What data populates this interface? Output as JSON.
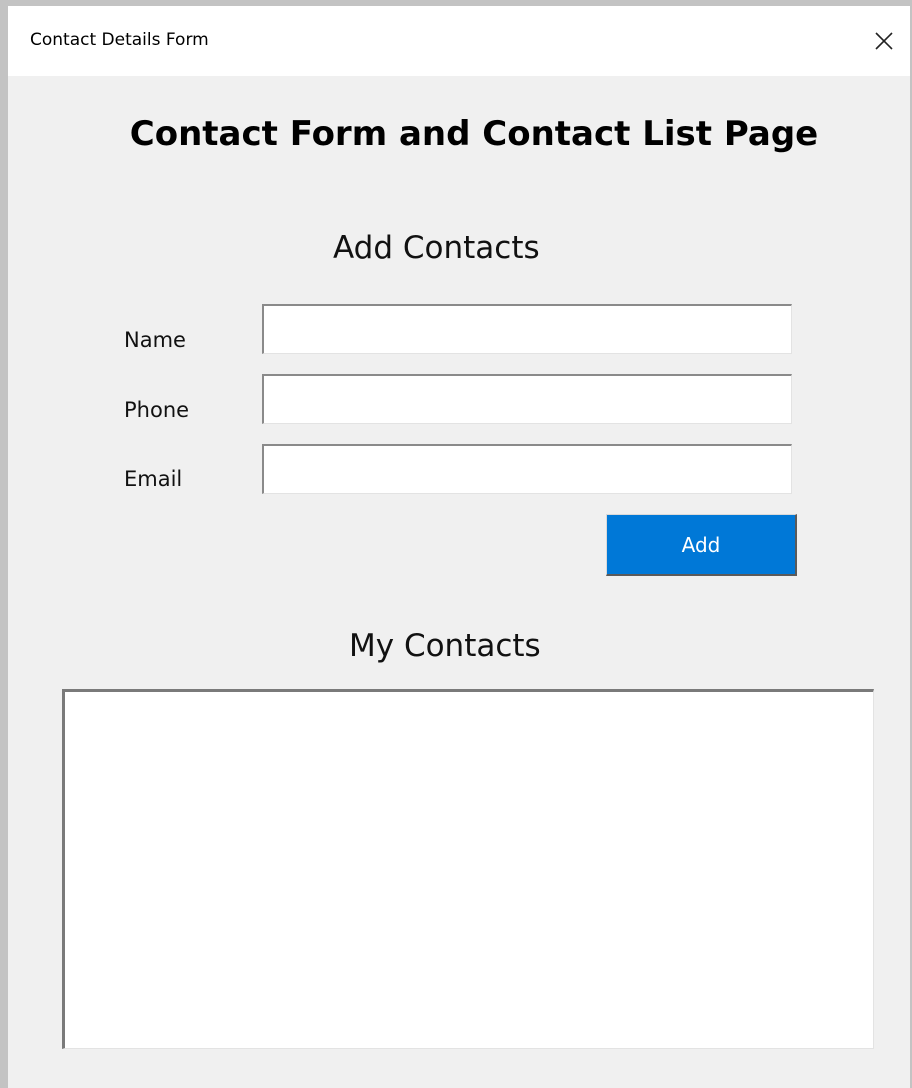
{
  "window": {
    "title": "Contact Details Form",
    "close_icon": "close-icon"
  },
  "form": {
    "main_title": "Contact Form and Contact List Page",
    "add_heading": "Add Contacts",
    "fields": [
      {
        "label": "Name",
        "value": "",
        "placeholder": ""
      },
      {
        "label": "Phone",
        "value": "",
        "placeholder": ""
      },
      {
        "label": "Email",
        "value": "",
        "placeholder": ""
      }
    ],
    "add_button_label": "Add",
    "accent_color": "#0078d7"
  },
  "contacts": {
    "heading": "My Contacts",
    "items": []
  }
}
